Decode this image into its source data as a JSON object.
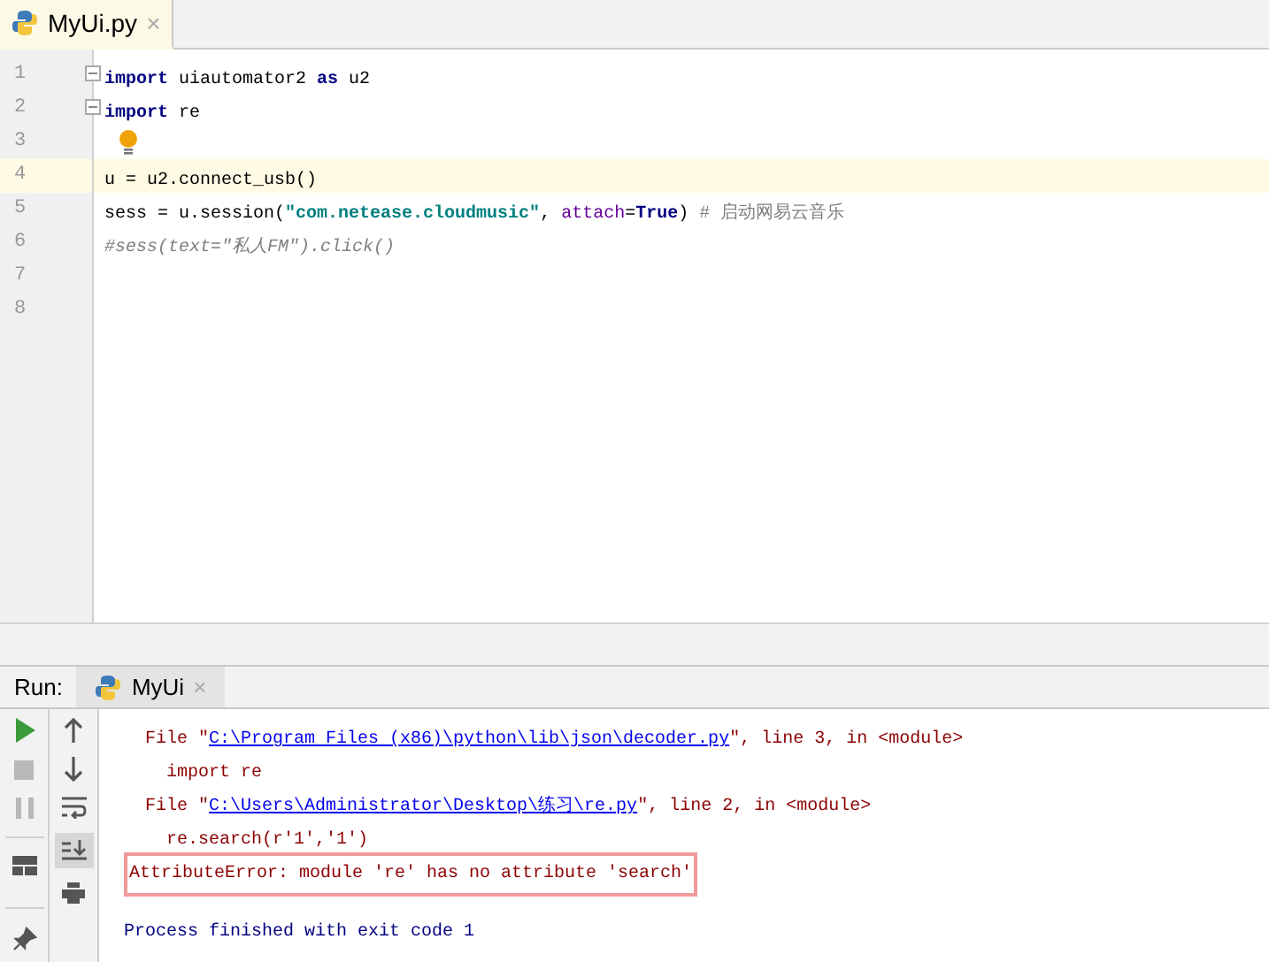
{
  "editor_tabs": [
    {
      "label": "MyUi.py",
      "close": "×",
      "selected": true
    }
  ],
  "code_lines": [
    {
      "number": "1",
      "current": false,
      "fold": true,
      "bulb": false,
      "segments": [
        {
          "kind": "keyword",
          "text": "import"
        },
        {
          "kind": "plain",
          "text": " uiautomator2 "
        },
        {
          "kind": "keyword",
          "text": "as"
        },
        {
          "kind": "plain",
          "text": " u2"
        }
      ]
    },
    {
      "number": "2",
      "current": false,
      "fold": true,
      "bulb": false,
      "segments": [
        {
          "kind": "keyword",
          "text": "import"
        },
        {
          "kind": "plain",
          "text": " re"
        }
      ]
    },
    {
      "number": "3",
      "current": false,
      "fold": false,
      "bulb": true
    },
    {
      "number": "4",
      "current": true,
      "fold": false,
      "bulb": false,
      "segments": [
        {
          "kind": "plain",
          "text": "u = u2.connect_usb()"
        }
      ]
    },
    {
      "number": "5",
      "current": false,
      "fold": false,
      "bulb": false,
      "segments": [
        {
          "kind": "plain",
          "text": "sess = u.session("
        },
        {
          "kind": "string",
          "text": "\"com.netease.cloudmusic\""
        },
        {
          "kind": "plain",
          "text": ", "
        },
        {
          "kind": "param",
          "text": "attach"
        },
        {
          "kind": "plain",
          "text": "="
        },
        {
          "kind": "keyword",
          "text": "True"
        },
        {
          "kind": "plain",
          "text": ") "
        },
        {
          "kind": "comment",
          "text": "# 启动网易云音乐"
        }
      ]
    },
    {
      "number": "6",
      "current": false,
      "fold": false,
      "bulb": false,
      "segments": [
        {
          "kind": "comment-italic",
          "text": "#sess(text=\"私人FM\").click()"
        }
      ]
    },
    {
      "number": "7",
      "current": false,
      "fold": false,
      "bulb": false
    },
    {
      "number": "8",
      "current": false,
      "fold": false,
      "bulb": false
    }
  ],
  "run_panel": {
    "label": "Run:",
    "tabs": [
      {
        "label": "MyUi",
        "close": "×",
        "selected": true
      }
    ]
  },
  "console_lines": [
    {
      "kind": "normal",
      "segments": [
        {
          "kind": "text",
          "text": "  File \""
        },
        {
          "kind": "link",
          "text": "C:\\Program Files (x86)\\python\\lib\\json\\decoder.py"
        },
        {
          "kind": "text",
          "text": "\", line 3, in <module>"
        }
      ]
    },
    {
      "kind": "normal",
      "segments": [
        {
          "kind": "text",
          "text": "    import re"
        }
      ]
    },
    {
      "kind": "normal",
      "segments": [
        {
          "kind": "text",
          "text": "  File \""
        },
        {
          "kind": "link",
          "text": "C:\\Users\\Administrator\\Desktop\\练习\\re.py"
        },
        {
          "kind": "text",
          "text": "\", line 2, in <module>"
        }
      ]
    },
    {
      "kind": "normal",
      "segments": [
        {
          "kind": "text",
          "text": "    re.search(r'1','1')"
        }
      ]
    },
    {
      "kind": "boxed",
      "segments": [
        {
          "kind": "text",
          "text": "AttributeError: module 're' has no attribute 'search'"
        }
      ]
    },
    {
      "kind": "blank"
    },
    {
      "kind": "info",
      "segments": [
        {
          "kind": "text",
          "text": "Process finished with exit code 1"
        }
      ]
    }
  ]
}
